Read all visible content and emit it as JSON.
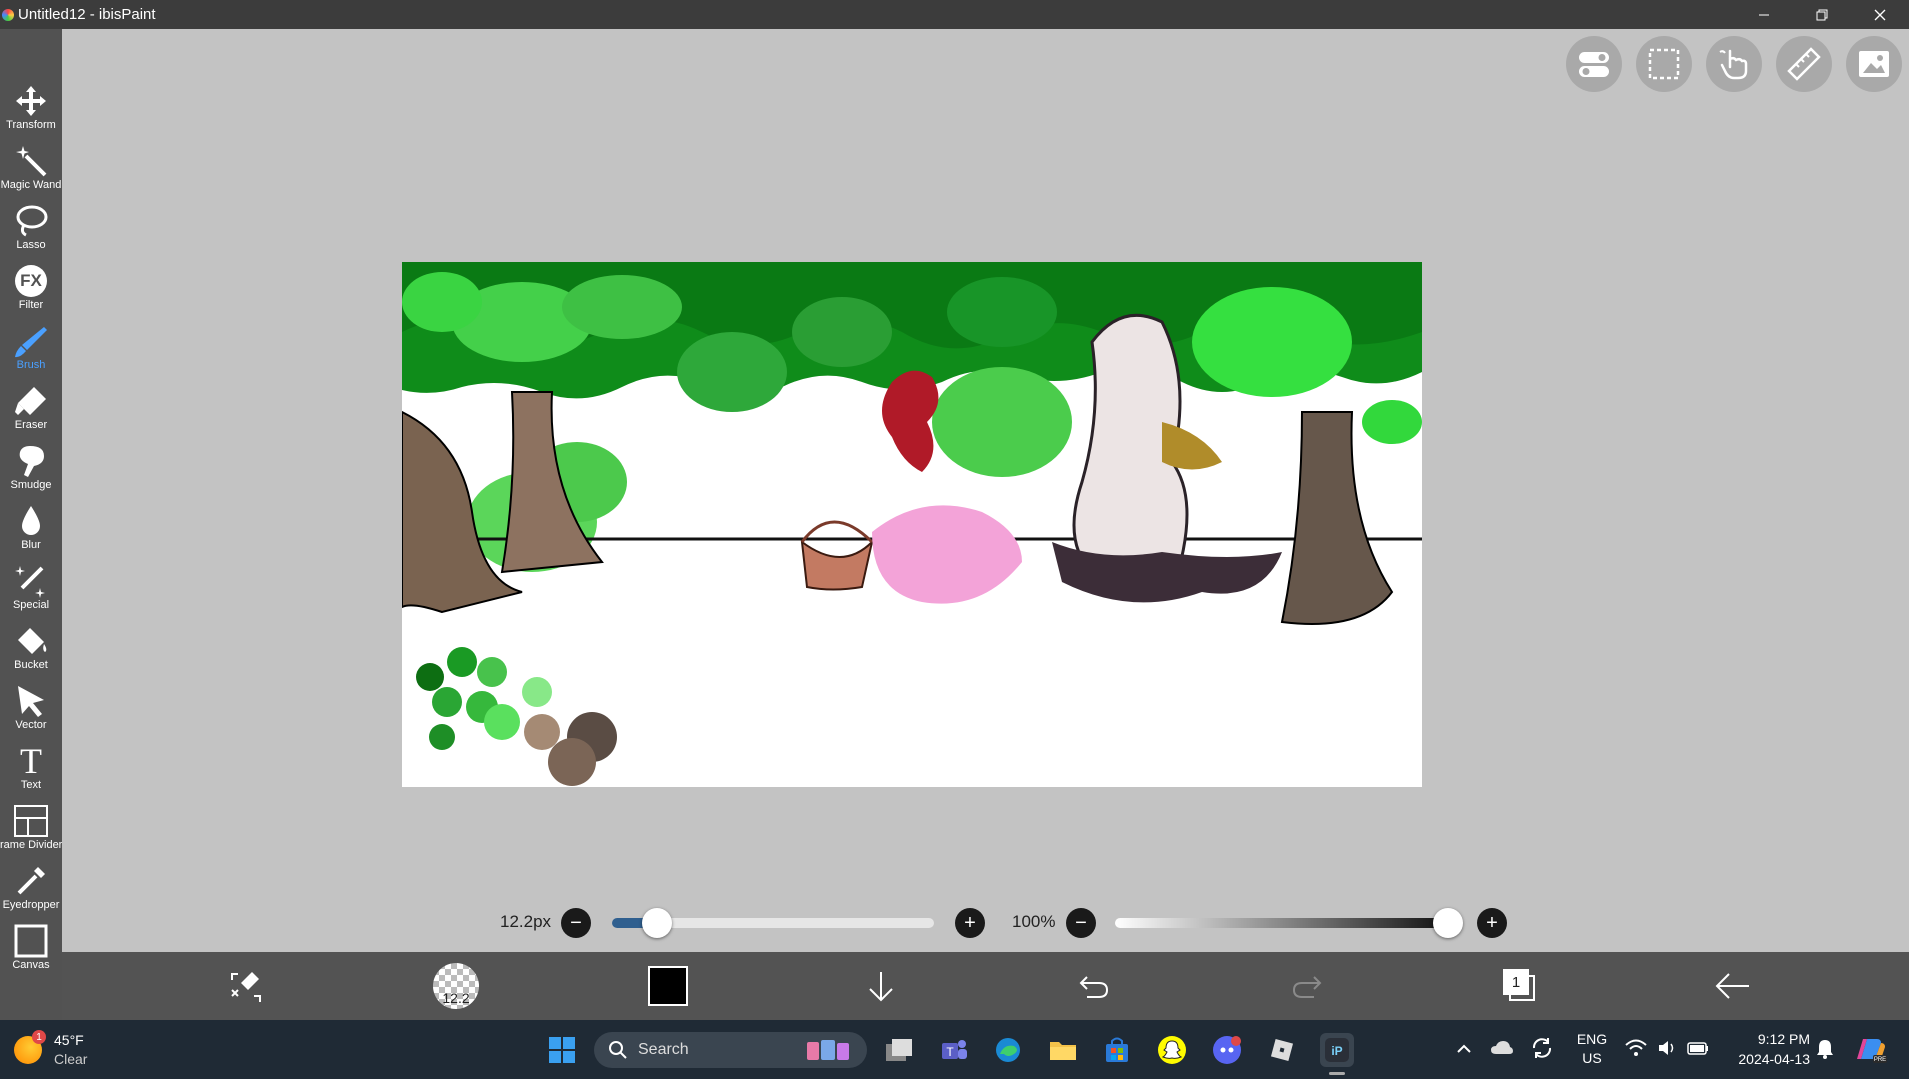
{
  "window": {
    "title": "Untitled12 - ibisPaint"
  },
  "tools": [
    {
      "name": "transform",
      "label": "Transform"
    },
    {
      "name": "magic-wand",
      "label": "Magic Wand"
    },
    {
      "name": "lasso",
      "label": "Lasso"
    },
    {
      "name": "filter",
      "label": "Filter"
    },
    {
      "name": "brush",
      "label": "Brush",
      "active": true
    },
    {
      "name": "eraser",
      "label": "Eraser"
    },
    {
      "name": "smudge",
      "label": "Smudge"
    },
    {
      "name": "blur",
      "label": "Blur"
    },
    {
      "name": "special",
      "label": "Special"
    },
    {
      "name": "bucket",
      "label": "Bucket"
    },
    {
      "name": "vector",
      "label": "Vector"
    },
    {
      "name": "text",
      "label": "Text"
    },
    {
      "name": "frame-divider",
      "label": "rame Divider"
    },
    {
      "name": "eyedropper",
      "label": "Eyedropper"
    },
    {
      "name": "canvas",
      "label": "Canvas"
    }
  ],
  "filter_icon_text": "FX",
  "text_icon_text": "T",
  "brush": {
    "size_label": "12.2px",
    "size_fraction": 0.14,
    "opacity_label": "100%",
    "opacity_fraction": 1.0,
    "preview_text": "12.2"
  },
  "colors": {
    "current_color": "#000000",
    "brush_accent": "#4aa0ff",
    "slider_fill": "#2f5f8f"
  },
  "layers": {
    "count_label": "1"
  },
  "taskbar": {
    "weather_temp": "45°F",
    "weather_desc": "Clear",
    "weather_badge": "1",
    "search_placeholder": "Search",
    "lang_top": "ENG",
    "lang_bottom": "US",
    "time": "9:12 PM",
    "date": "2024-04-13"
  }
}
